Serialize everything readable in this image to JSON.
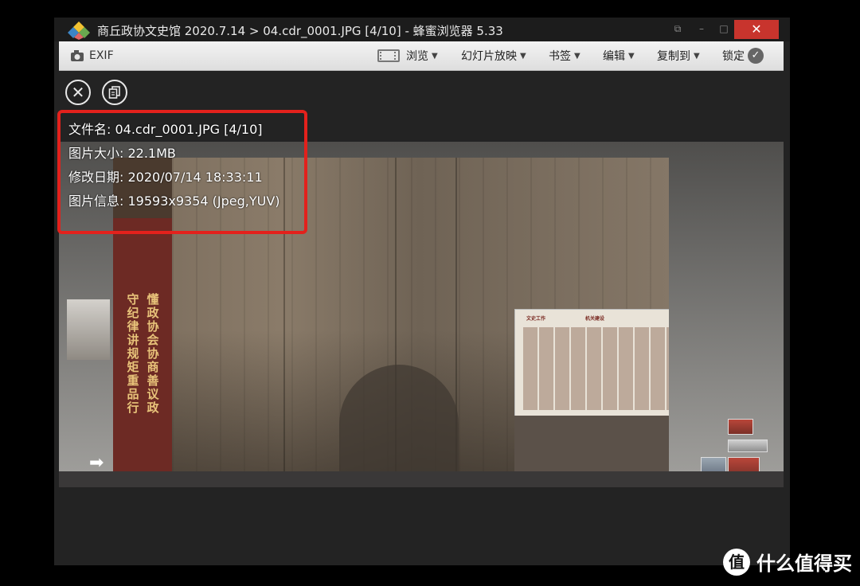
{
  "window": {
    "title": "商丘政协文史馆 2020.7.14 > 04.cdr_0001.JPG [4/10] - 蜂蜜浏览器 5.33",
    "controls": {
      "restore": "⧉",
      "minimize": "–",
      "maximize": "□",
      "close": "✕"
    }
  },
  "toolbar": {
    "exif_label": "EXIF",
    "browse_label": "浏览",
    "slideshow_label": "幻灯片放映",
    "bookmarks_label": "书签",
    "edit_label": "编辑",
    "copy_to_label": "复制到",
    "lock_label": "锁定"
  },
  "image_info": {
    "filename": "文件名: 04.cdr_0001.JPG [4/10]",
    "size": "图片大小: 22.1MB",
    "modified": "修改日期: 2020/07/14 18:33:11",
    "info": "图片信息: 19593x9354 (Jpeg,YUV)"
  },
  "photo": {
    "band_col_a": "守纪律 讲规矩 重品行",
    "band_col_b": "懂政协 会协商 善议政",
    "poster_title_left": "文史工作",
    "poster_title_right": "机关建设"
  },
  "watermark": {
    "logo": "值",
    "text": "什么值得买"
  },
  "icons": [
    "app-logo-icon",
    "camera-icon",
    "filmstrip-icon",
    "caret-down-icon",
    "lock-check-icon",
    "close-icon",
    "copy-icon",
    "next-arrow-icon"
  ],
  "colors": {
    "highlight": "#e3211c",
    "close_button": "#c8342d"
  }
}
